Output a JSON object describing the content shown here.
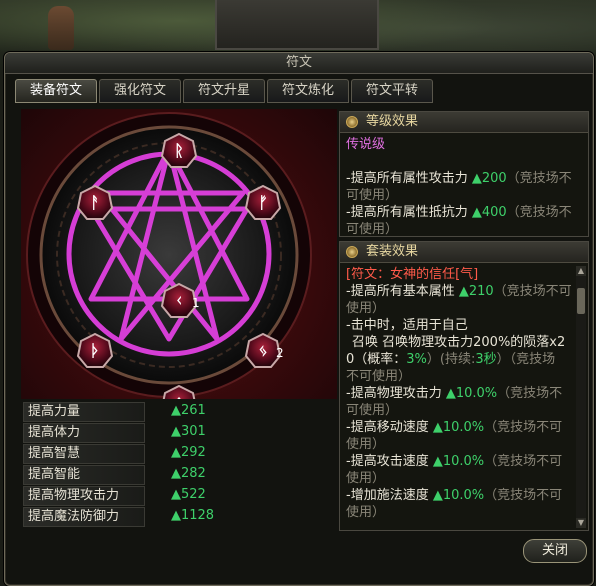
{
  "window": {
    "title": "符文"
  },
  "tabs": [
    {
      "label": "装备符文",
      "active": true
    },
    {
      "label": "强化符文",
      "active": false
    },
    {
      "label": "符文升星",
      "active": false
    },
    {
      "label": "符文炼化",
      "active": false
    },
    {
      "label": "符文平转",
      "active": false
    }
  ],
  "runes": [
    {
      "glyph": "ᚱ",
      "count": ""
    },
    {
      "glyph": "ᚨ",
      "count": ""
    },
    {
      "glyph": "ᚠ",
      "count": ""
    },
    {
      "glyph": "ᚲ",
      "count": "1"
    },
    {
      "glyph": "ᚦ",
      "count": ""
    },
    {
      "glyph": "ᛃ",
      "count": "2"
    },
    {
      "glyph": "ᛟ",
      "count": ""
    }
  ],
  "stats": [
    {
      "label": "提高力量",
      "value": "▲261"
    },
    {
      "label": "提高体力",
      "value": "▲301"
    },
    {
      "label": "提高智慧",
      "value": "▲292"
    },
    {
      "label": "提高智能",
      "value": "▲282"
    },
    {
      "label": "提高物理攻击力",
      "value": "▲522"
    },
    {
      "label": "提高魔法防御力",
      "value": "▲1128"
    }
  ],
  "level_effect": {
    "header": "等级效果",
    "grade": "传说级",
    "lines": [
      {
        "text": "-提高所有属性攻击力 ",
        "value": "▲200",
        "note": "（竞技场不可使用）"
      },
      {
        "text": "-提高所有属性抵抗力 ",
        "value": "▲400",
        "note": "（竞技场不可使用）"
      }
    ]
  },
  "set_effect": {
    "header": "套装效果",
    "set_name": "[符文：女神的信任[气]",
    "base_attr": {
      "text": "-提高所有基本属性 ",
      "value": "▲210",
      "note": "（竞技场不可使用）"
    },
    "on_hit": "-击中时，适用于自己",
    "summon_1": "召唤 召唤物理攻击力200%的陨落x2",
    "summon_2": "0（概率：",
    "summon_prob": "3%",
    "summon_3": "）(持续:",
    "summon_dur": "3秒",
    "summon_4": "）（竞技场",
    "summon_5": "不可使用）",
    "lines": [
      {
        "text": "-提高物理攻击力 ",
        "value": "▲10.0%",
        "note": "（竞技场不可使用）"
      },
      {
        "text": "-提高移动速度 ",
        "value": "▲10.0%",
        "note": "（竞技场不可使用）"
      },
      {
        "text": "-提高攻击速度 ",
        "value": "▲10.0%",
        "note": "（竞技场不可使用）"
      },
      {
        "text": "-增加施法速度 ",
        "value": "▲10.0%",
        "note": "（竞技场不可使用）"
      }
    ]
  },
  "buttons": {
    "close": "关闭"
  },
  "colors": {
    "grade": "#e070e0",
    "increase": "#3ed06a",
    "set_name": "#ff5a4a",
    "rune_line": "#e040e0"
  }
}
